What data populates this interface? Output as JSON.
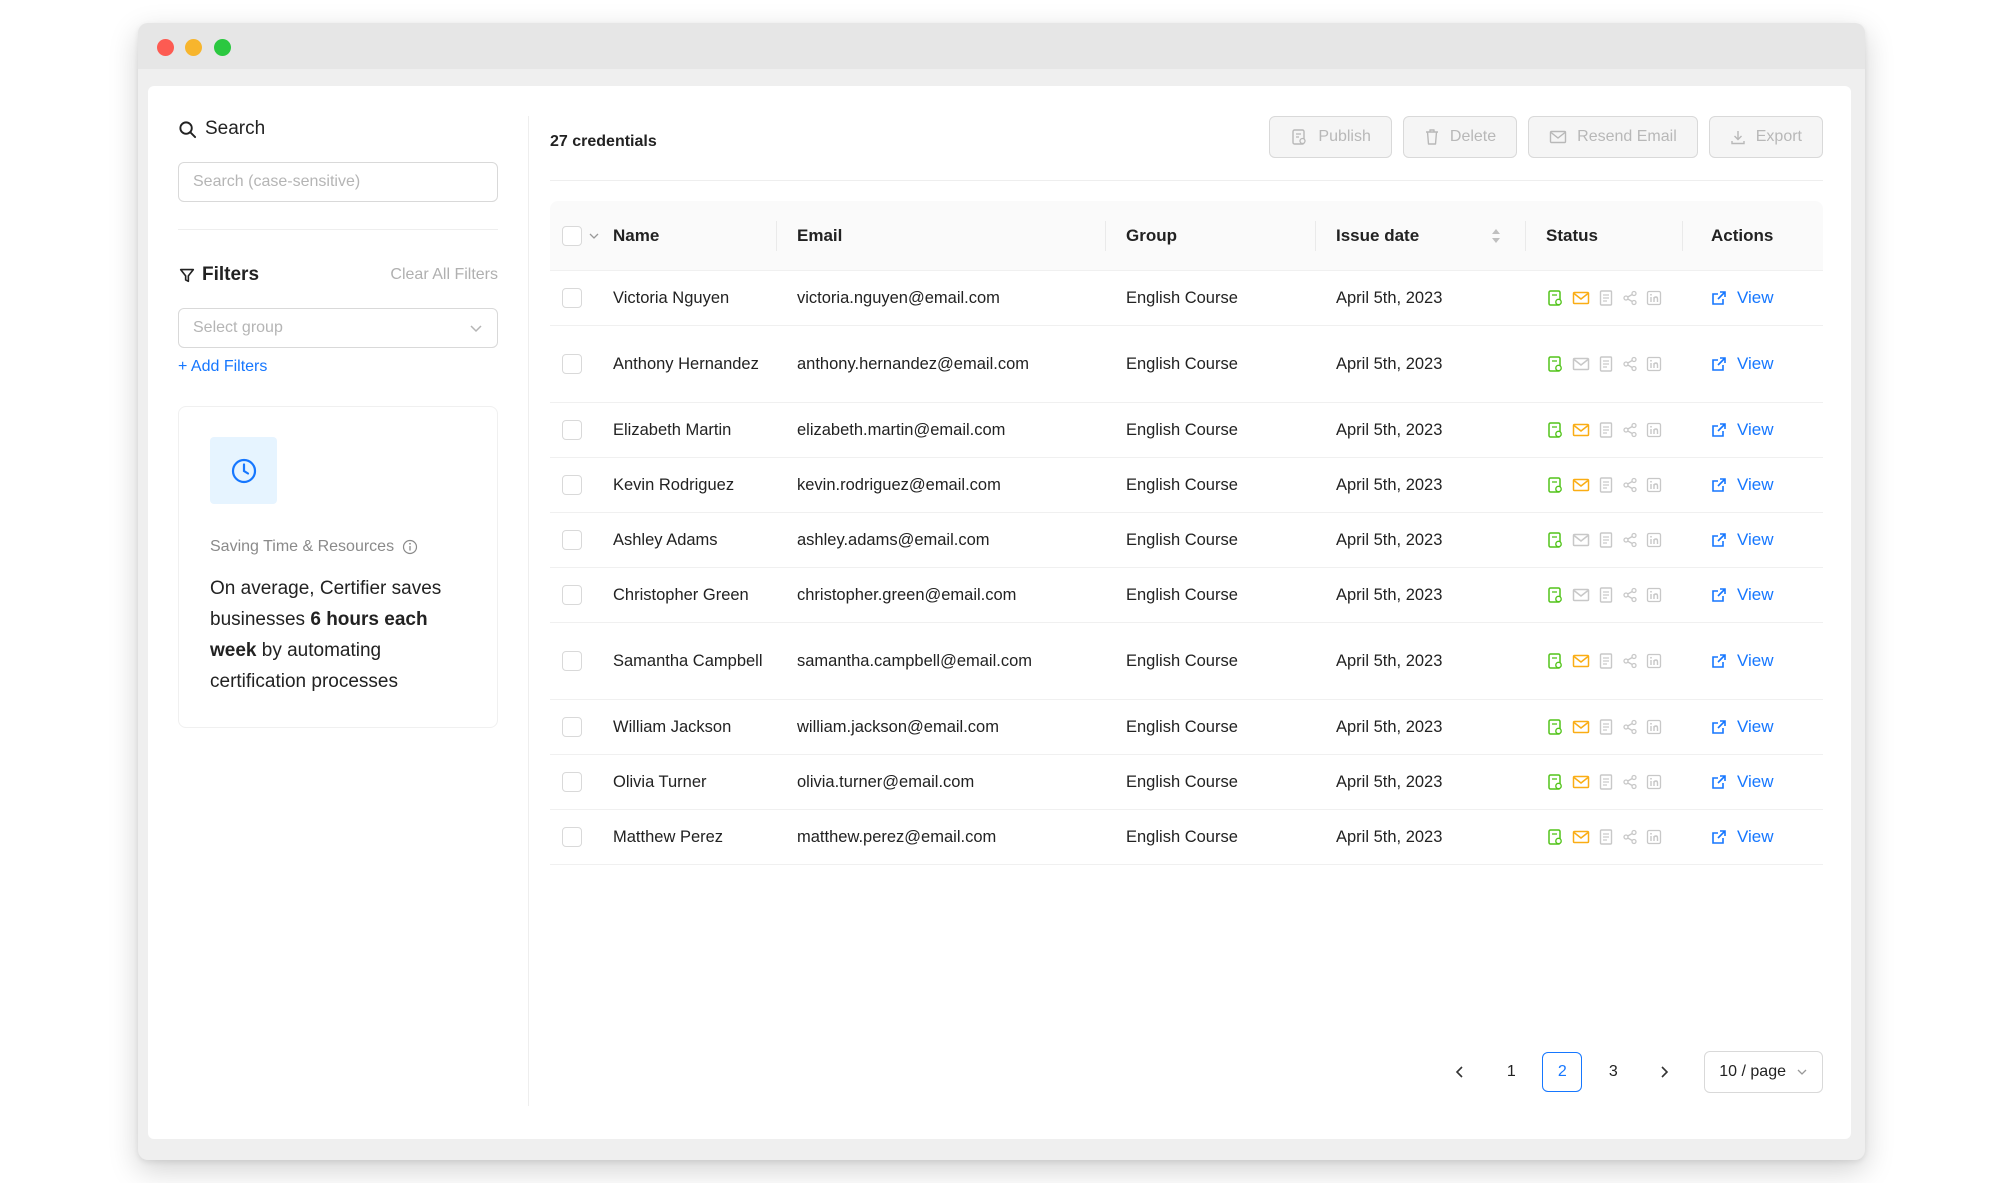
{
  "sidebar": {
    "search_title": "Search",
    "search_placeholder": "Search (case-sensitive)",
    "filters_title": "Filters",
    "clear_filters": "Clear All Filters",
    "select_group_placeholder": "Select group",
    "add_filters": "+ Add Filters",
    "card": {
      "label": "Saving Time & Resources",
      "text_part1": "On average, Certifier saves businesses ",
      "text_bold1": "6 hours each week",
      "text_part2": " by automating certification processes"
    }
  },
  "main": {
    "count_label": "27 credentials",
    "toolbar": {
      "publish": "Publish",
      "delete": "Delete",
      "resend_email": "Resend Email",
      "export": "Export"
    },
    "columns": {
      "name": "Name",
      "email": "Email",
      "group": "Group",
      "issue_date": "Issue date",
      "status": "Status",
      "actions": "Actions"
    },
    "view_label": "View",
    "rows": [
      {
        "name": "Victoria Nguyen",
        "email": "victoria.nguyen@email.com",
        "group": "English Course",
        "issue_date": "April 5th, 2023",
        "email_sent": true,
        "tall": false
      },
      {
        "name": "Anthony Hernandez",
        "email": "anthony.hernandez@email.com",
        "group": "English Course",
        "issue_date": "April 5th, 2023",
        "email_sent": false,
        "tall": true
      },
      {
        "name": "Elizabeth Martin",
        "email": "elizabeth.martin@email.com",
        "group": "English Course",
        "issue_date": "April 5th, 2023",
        "email_sent": true,
        "tall": false
      },
      {
        "name": "Kevin Rodriguez",
        "email": "kevin.rodriguez@email.com",
        "group": "English Course",
        "issue_date": "April 5th, 2023",
        "email_sent": true,
        "tall": false
      },
      {
        "name": "Ashley Adams",
        "email": "ashley.adams@email.com",
        "group": "English Course",
        "issue_date": "April 5th, 2023",
        "email_sent": false,
        "tall": false
      },
      {
        "name": "Christopher Green",
        "email": "christopher.green@email.com",
        "group": "English Course",
        "issue_date": "April 5th, 2023",
        "email_sent": false,
        "tall": false
      },
      {
        "name": "Samantha Campbell",
        "email": "samantha.campbell@email.com",
        "group": "English Course",
        "issue_date": "April 5th, 2023",
        "email_sent": true,
        "tall": true
      },
      {
        "name": "William Jackson",
        "email": "william.jackson@email.com",
        "group": "English Course",
        "issue_date": "April 5th, 2023",
        "email_sent": true,
        "tall": false
      },
      {
        "name": "Olivia Turner",
        "email": "olivia.turner@email.com",
        "group": "English Course",
        "issue_date": "April 5th, 2023",
        "email_sent": true,
        "tall": false
      },
      {
        "name": "Matthew Perez",
        "email": "matthew.perez@email.com",
        "group": "English Course",
        "issue_date": "April 5th, 2023",
        "email_sent": true,
        "tall": false
      }
    ],
    "pagination": {
      "pages": [
        "1",
        "2",
        "3"
      ],
      "current": "2",
      "page_size": "10 / page"
    }
  },
  "colors": {
    "accent": "#1677ff",
    "status_green": "#52c41a",
    "status_orange": "#faad14",
    "status_gray": "#c8c8c8"
  },
  "icons": [
    "search-icon",
    "filter-icon",
    "chevron-down-icon",
    "clock-icon",
    "info-icon",
    "publish-icon",
    "trash-icon",
    "mail-icon",
    "download-icon",
    "sort-icon",
    "certificate-icon",
    "document-icon",
    "share-icon",
    "linkedin-icon",
    "external-link-icon",
    "chevron-left-icon",
    "chevron-right-icon"
  ]
}
